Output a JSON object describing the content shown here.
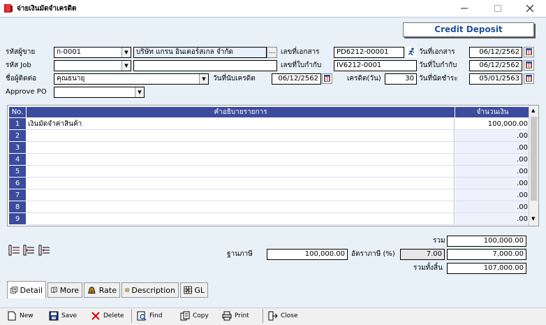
{
  "window": {
    "title": "จ่ายเงินมัดจำเครดิต",
    "minimize_icon": "minimize-icon",
    "maximize_icon": "maximize-icon",
    "close_icon": "close-icon"
  },
  "credit_button": {
    "label": "Credit  Deposit"
  },
  "form": {
    "supplier_code_label": "รหัสผู้ขาย",
    "supplier_code": "ก-0001",
    "supplier_name": "บริษัท แกรน อินเตอร์สเกล จำกัด",
    "browse_label": "...",
    "job_code_label": "รหัส Job",
    "job_code": "",
    "job_name": "",
    "contact_label": "ชื่อผู้ติดต่อ",
    "contact": "คุณธนายุ",
    "approve_po_label": "Approve PO",
    "approve_po": "",
    "doc_no_label": "เลขที่เอกสาร",
    "doc_no": "PD6212-00001",
    "invoice_no_label": "เลขที่ใบกำกับ",
    "invoice_no": "IV6212-0001",
    "credit_start_label": "วันที่นับเครดิต",
    "credit_start": "06/12/2562",
    "credit_days_label": "เครดิต(วัน)",
    "credit_days": "30",
    "doc_date_label": "วันที่เอกสาร",
    "doc_date": "06/12/2562",
    "invoice_date_label": "วันที่ใบกำกับ",
    "invoice_date": "06/12/2562",
    "due_date_label": "วันที่นัดชำระ",
    "due_date": "05/01/2563"
  },
  "grid": {
    "headers": {
      "no": "No.",
      "desc": "คำอธิบายรายการ",
      "amount": "จำนวนเงิน"
    },
    "rows": [
      {
        "no": "1",
        "desc": "เงินมัดจำค่าสินค้า",
        "amount": "100,000.00"
      },
      {
        "no": "2",
        "desc": "",
        "amount": ".00"
      },
      {
        "no": "3",
        "desc": "",
        "amount": ".00"
      },
      {
        "no": "4",
        "desc": "",
        "amount": ".00"
      },
      {
        "no": "5",
        "desc": "",
        "amount": ".00"
      },
      {
        "no": "6",
        "desc": "",
        "amount": ".00"
      },
      {
        "no": "7",
        "desc": "",
        "amount": ".00"
      },
      {
        "no": "8",
        "desc": "",
        "amount": ".00"
      },
      {
        "no": "9",
        "desc": "",
        "amount": ".00"
      }
    ]
  },
  "totals": {
    "total_label": "รวม",
    "total": "100,000.00",
    "tax_base_label": "ฐานภาษี",
    "tax_base": "100,000.00",
    "tax_rate_label": "อัตราภาษี (%)",
    "tax_rate": "7.00",
    "tax_amount": "7,000.00",
    "grand_total_label": "รวมทั้งสิ้น",
    "grand_total": "107,000.00"
  },
  "tabs": [
    {
      "label": "Detail",
      "icon": "detail-icon"
    },
    {
      "label": "More",
      "icon": "more-icon"
    },
    {
      "label": "Rate",
      "icon": "rate-icon"
    },
    {
      "label": "Description",
      "icon": "description-icon"
    },
    {
      "label": "GL",
      "icon": "gl-icon"
    }
  ],
  "toolbar": {
    "new": "New",
    "save": "Save",
    "delete": "Delete",
    "find": "Find",
    "copy": "Copy",
    "print": "Print",
    "close": "Close"
  },
  "colors": {
    "grid_header": "#3c4b9c",
    "credit_text": "#1f4e9c",
    "form_bg": "#e8f0f8"
  }
}
